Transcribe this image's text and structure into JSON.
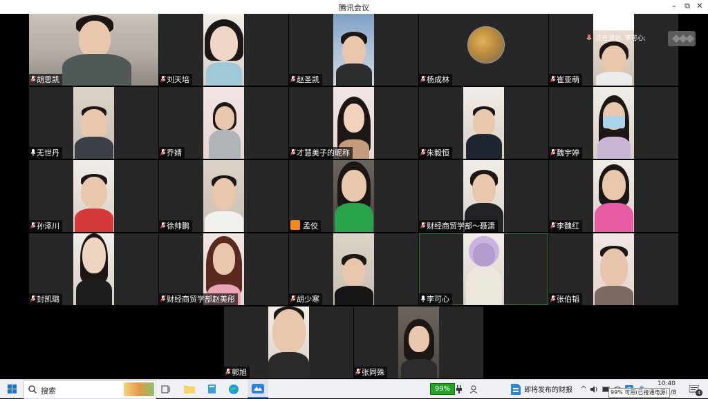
{
  "window": {
    "title": "腾讯会议",
    "controls": [
      "–",
      "⧉",
      "✕"
    ]
  },
  "speaking": {
    "label": "正在讲话:",
    "name": "李可心;"
  },
  "participants": [
    {
      "name": "胡思凯"
    },
    {
      "name": "刘天培"
    },
    {
      "name": "赵圣凯"
    },
    {
      "name": "杨成林"
    },
    {
      "name": "崔亚萌"
    },
    {
      "name": "无世丹"
    },
    {
      "name": "乔婧"
    },
    {
      "name": "才慧美子的昵称"
    },
    {
      "name": "朱毅恒"
    },
    {
      "name": "魏宇婷"
    },
    {
      "name": "孙泽川"
    },
    {
      "name": "徐帅鹏"
    },
    {
      "name": "孟佼"
    },
    {
      "name": "财经商贸学部～聂潇"
    },
    {
      "name": "李魏红"
    },
    {
      "name": "封凯璐"
    },
    {
      "name": "财经商贸学部赵美彤"
    },
    {
      "name": "胡少寒"
    },
    {
      "name": "李可心"
    },
    {
      "name": "张伯韬"
    },
    {
      "name": "郭旭"
    },
    {
      "name": "张同殊"
    }
  ],
  "taskbar": {
    "search_placeholder": "搜索",
    "battery": "99%",
    "news": "即将发布的财报",
    "time": "10:40",
    "date": "2/8",
    "notifications": "4",
    "battery_tooltip": "99% 可用(已接通电源)"
  },
  "colors": {
    "tile_bg": "#272727",
    "active_border": "#2e7d32",
    "battery": "#23a323"
  }
}
